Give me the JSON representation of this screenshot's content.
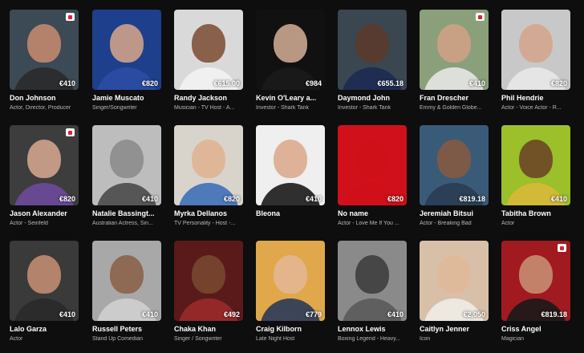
{
  "talent": [
    {
      "name": "Don Johnson",
      "desc": "Actor, Director, Producer",
      "price": "€410",
      "flag": true,
      "bg": "#3c4a55",
      "face": "#c98c6e",
      "body": "#2a2a2a"
    },
    {
      "name": "Jamie Muscato",
      "desc": "Singer/Songwriter",
      "price": "€820",
      "flag": false,
      "bg": "#1e3f8c",
      "face": "#d8a78a",
      "body": "#2b4da3"
    },
    {
      "name": "Randy Jackson",
      "desc": "Musician - TV Host - A...",
      "price": "€615.00",
      "flag": false,
      "bg": "#d9d9d9",
      "face": "#7a4a30",
      "body": "#f2f2f2"
    },
    {
      "name": "Kevin O'Leary a...",
      "desc": "Investor - Shark Tank",
      "price": "€984",
      "flag": false,
      "bg": "#111111",
      "face": "#d7b098",
      "body": "#1b1b1b"
    },
    {
      "name": "Daymond John",
      "desc": "Investor - Shark Tank",
      "price": "€655.18",
      "flag": false,
      "bg": "#3a4650",
      "face": "#5c3a28",
      "body": "#1e2a52"
    },
    {
      "name": "Fran Drescher",
      "desc": "Emmy & Golden Globe...",
      "price": "€410",
      "flag": true,
      "bg": "#8aa07a",
      "face": "#d2a085",
      "body": "#e6e6e6"
    },
    {
      "name": "Phil Hendrie",
      "desc": "Actor - Voice Actor - R...",
      "price": "€820",
      "flag": false,
      "bg": "#c8c8c8",
      "face": "#d3a58b",
      "body": "#e8e8e8"
    },
    {
      "name": "Jason Alexander",
      "desc": "Actor - Seinfeld",
      "price": "€820",
      "flag": true,
      "bg": "#3d3d3d",
      "face": "#d8a990",
      "body": "#6a4a9a"
    },
    {
      "name": "Natalie Bassingt...",
      "desc": "Australian Actress, Sin...",
      "price": "€410",
      "flag": false,
      "bg": "#bdbdbd",
      "face": "#8a8a8a",
      "body": "#4a4a4a"
    },
    {
      "name": "Myrka Dellanos",
      "desc": "TV Personality - Host -...",
      "price": "€820",
      "flag": false,
      "bg": "#d8d4cc",
      "face": "#e0b28e",
      "body": "#3f6fb8"
    },
    {
      "name": "Bleona",
      "desc": "",
      "price": "€410",
      "flag": false,
      "bg": "#efefef",
      "face": "#d9a789",
      "body": "#1a1a1a"
    },
    {
      "name": "No name",
      "desc": "Actor - Love Me If You ...",
      "price": "€820",
      "flag": false,
      "bg": "#d0101a",
      "face": "#d0101a",
      "body": "#d0101a"
    },
    {
      "name": "Jeremiah Bitsui",
      "desc": "Actor - Breaking Bad",
      "price": "€819.18",
      "flag": false,
      "bg": "#3a5b78",
      "face": "#8a5a3e",
      "body": "#2a3c52"
    },
    {
      "name": "Tabitha Brown",
      "desc": "Actor",
      "price": "€410",
      "flag": false,
      "bg": "#9bc02a",
      "face": "#6a3e26",
      "body": "#d8b83a"
    },
    {
      "name": "Lalo Garza",
      "desc": "Actor",
      "price": "€410",
      "flag": false,
      "bg": "#3a3a3a",
      "face": "#c99074",
      "body": "#2a2a2a"
    },
    {
      "name": "Russell Peters",
      "desc": "Stand Up Comedian",
      "price": "€410",
      "flag": false,
      "bg": "#a8a8a8",
      "face": "#8a5e44",
      "body": "#cfcfcf"
    },
    {
      "name": "Chaka Khan",
      "desc": "Singer / Songwriter",
      "price": "€492",
      "flag": false,
      "bg": "#5a1a1a",
      "face": "#7a4a32",
      "body": "#9a2a2a"
    },
    {
      "name": "Craig Kilborn",
      "desc": "Late Night Host",
      "price": "€779",
      "flag": false,
      "bg": "#e0a84a",
      "face": "#e4b696",
      "body": "#2a3a5a"
    },
    {
      "name": "Lennox Lewis",
      "desc": "Boxing Legend - Heavy...",
      "price": "€410",
      "flag": false,
      "bg": "#8a8a8a",
      "face": "#3a3a3a",
      "body": "#5a5a5a"
    },
    {
      "name": "Caitlyn Jenner",
      "desc": "Icon",
      "price": "€2,050",
      "flag": false,
      "bg": "#d8c0a8",
      "face": "#e0b898",
      "body": "#f0ece6"
    },
    {
      "name": "Criss Angel",
      "desc": "Magician",
      "price": "€819.18",
      "flag": true,
      "bg": "#a01a20",
      "face": "#c99478",
      "body": "#1a1a1a"
    }
  ]
}
